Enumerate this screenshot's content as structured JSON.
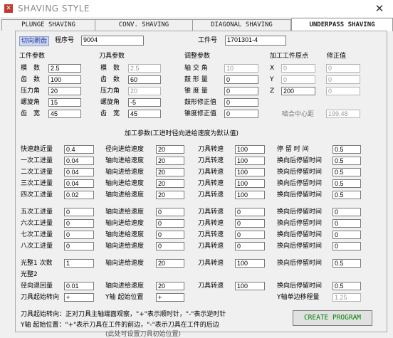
{
  "window": {
    "title": "SHAVING STYLE",
    "close": "✕"
  },
  "tabs": [
    "PLUNGE SHAVING",
    "CONV. SHAVING",
    "DIAGONAL SHAVING",
    "UNDERPASS SHAVING"
  ],
  "header": {
    "mode": "切向剃齿",
    "program_no_label": "程序号",
    "program_no": "9004",
    "workpiece_no_label": "工件号",
    "workpiece_no": "1701301-4"
  },
  "workpiece_params": {
    "title": "工件参数",
    "rows": [
      {
        "label": "模　数",
        "value": "2.5"
      },
      {
        "label": "齿　数",
        "value": "100"
      },
      {
        "label": "压力角",
        "value": "20"
      },
      {
        "label": "螺旋角",
        "value": "15"
      },
      {
        "label": "齿　宽",
        "value": "45"
      }
    ]
  },
  "tool_params": {
    "title": "刀具参数",
    "rows": [
      {
        "label": "模　数",
        "value": "2.5"
      },
      {
        "label": "齿　数",
        "value": "60"
      },
      {
        "label": "压力角",
        "value": "20"
      },
      {
        "label": "螺旋角",
        "value": "-5"
      },
      {
        "label": "齿　宽",
        "value": "45"
      }
    ]
  },
  "adjust_params": {
    "title": "调整参数",
    "rows": [
      {
        "label": "轴 交 角",
        "value": "10"
      },
      {
        "label": "鼓 形 量",
        "value": "0"
      },
      {
        "label": "锥 度 量",
        "value": "0"
      },
      {
        "label": "鼓形修正值",
        "value": "0"
      },
      {
        "label": "锥度修正值",
        "value": "0"
      }
    ]
  },
  "origin": {
    "title": "加工工件原点",
    "correction_title": "修正值",
    "rows": [
      {
        "axis": "X",
        "value": "0",
        "correction": "0"
      },
      {
        "axis": "Y",
        "value": "0",
        "correction": "0"
      },
      {
        "axis": "Z",
        "value": "200",
        "correction": "0"
      }
    ],
    "center_distance_label": "啮合中心距",
    "center_distance": "199.48"
  },
  "process_title": "加工参数(工进时径向进给速度为默认值)",
  "process": {
    "col1": [
      {
        "label": "快速趋近量",
        "value": "0.4"
      },
      {
        "label": "一次工进量",
        "value": "0.04"
      },
      {
        "label": "二次工进量",
        "value": "0.04"
      },
      {
        "label": "三次工进量",
        "value": "0.04"
      },
      {
        "label": "四次工进量",
        "value": "0.02"
      },
      {
        "label": "五次工进量",
        "value": "0"
      },
      {
        "label": "六次工进量",
        "value": "0"
      },
      {
        "label": "七次工进量",
        "value": "0"
      },
      {
        "label": "八次工进量",
        "value": "0"
      },
      {
        "label": "光整1 次数",
        "value": "1"
      },
      {
        "label": "光整2",
        "value": ""
      },
      {
        "label": "径向退回量",
        "value": "0.01"
      },
      {
        "label": "刀具起始转向",
        "value": "+"
      }
    ],
    "col2": [
      {
        "label": "径向进给速度",
        "value": "20"
      },
      {
        "label": "轴向进给速度",
        "value": "20"
      },
      {
        "label": "轴向进给速度",
        "value": "20"
      },
      {
        "label": "轴向进给速度",
        "value": "20"
      },
      {
        "label": "轴向进给速度",
        "value": "20"
      },
      {
        "label": "轴向进给速度",
        "value": "0"
      },
      {
        "label": "轴向进给速度",
        "value": "0"
      },
      {
        "label": "轴向进给速度",
        "value": "0"
      },
      {
        "label": "轴向进给速度",
        "value": "0"
      },
      {
        "label": "轴向进给速度",
        "value": "20"
      },
      {
        "label": "轴向进给速度",
        "value": "20"
      },
      {
        "label": "Y轴 起始位置",
        "value": "+"
      }
    ],
    "col3": [
      {
        "label": "刀具转速",
        "value": "100"
      },
      {
        "label": "刀具转速",
        "value": "100"
      },
      {
        "label": "刀具转速",
        "value": "100"
      },
      {
        "label": "刀具转速",
        "value": "100"
      },
      {
        "label": "刀具转速",
        "value": "100"
      },
      {
        "label": "刀具转速",
        "value": "0"
      },
      {
        "label": "刀具转速",
        "value": "0"
      },
      {
        "label": "刀具转速",
        "value": "0"
      },
      {
        "label": "刀具转速",
        "value": "0"
      },
      {
        "label": "刀具转速",
        "value": "100"
      },
      {
        "label": "刀具转速",
        "value": "100"
      }
    ],
    "col4": [
      {
        "label": "停 留 时 间",
        "value": "0.5"
      },
      {
        "label": "换向后停留时间",
        "value": "0.5"
      },
      {
        "label": "换向后停留时间",
        "value": "0.5"
      },
      {
        "label": "换向后停留时间",
        "value": "0.5"
      },
      {
        "label": "换向后停留时间",
        "value": "0.5"
      },
      {
        "label": "换向后停留时间",
        "value": "0"
      },
      {
        "label": "换向后停留时间",
        "value": "0"
      },
      {
        "label": "换向后停留时间",
        "value": "0"
      },
      {
        "label": "换向后停留时间",
        "value": "0"
      },
      {
        "label": "换向后停留时间",
        "value": "0.5"
      },
      {
        "label": "换向后停留时间",
        "value": "0.5"
      },
      {
        "label": "Y轴单边移程量",
        "value": "1.25"
      }
    ]
  },
  "notes": [
    "刀具起始转向：正对刀具主轴端面观察，\"+\"表示顺时针，\"-\"表示逆时针",
    "Y轴 起始位置：\"+\"表示刀具在工件的前边，\"-\"表示刀具在工件的后边",
    "(此处可设置刀具初始位置)"
  ],
  "create_button": "CREATE  PROGRAM"
}
